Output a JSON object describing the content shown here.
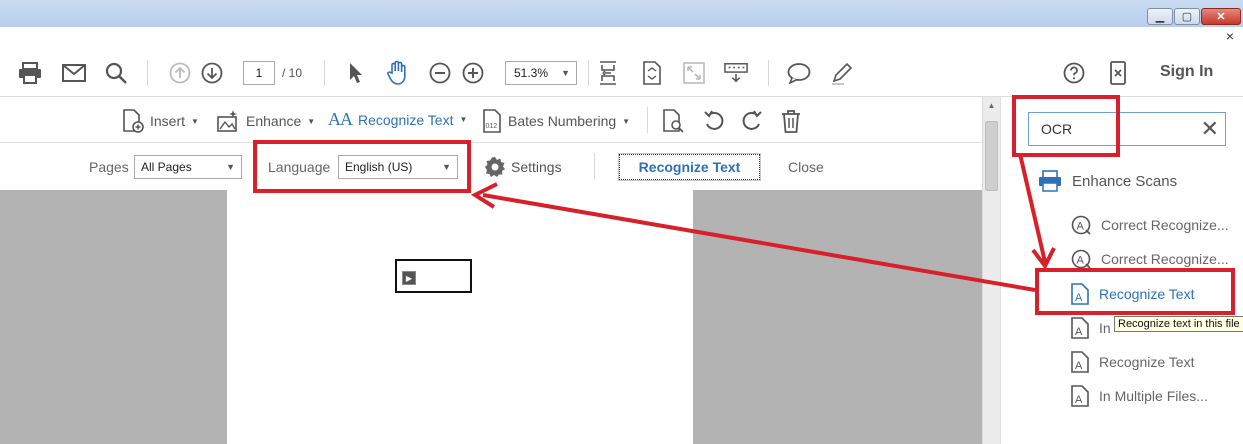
{
  "window": {
    "minimize": "▁",
    "maximize": "▢",
    "close": "✕",
    "pane_close": "×"
  },
  "toolbar": {
    "page_current": "1",
    "page_total": "/ 10",
    "zoom": "51.3%",
    "sign_in": "Sign In"
  },
  "tools": {
    "insert": "Insert",
    "enhance": "Enhance",
    "recognize_text": "Recognize Text",
    "bates_numbering": "Bates Numbering"
  },
  "options": {
    "pages_label": "Pages",
    "pages_value": "All Pages",
    "language_label": "Language",
    "language_value": "English (US)",
    "settings": "Settings",
    "recognize_button": "Recognize Text",
    "close": "Close"
  },
  "right_pane": {
    "search_value": "OCR",
    "group": "Enhance Scans",
    "items": [
      "Correct Recognize...",
      "Correct Recognize...",
      "Recognize Text",
      "In",
      "Recognize Text",
      "In Multiple Files..."
    ],
    "tooltip": "Recognize text in this file"
  },
  "colors": {
    "accent": "#2d72b8",
    "annotation_red": "#d8202a",
    "doc_background": "#b3b3b3"
  }
}
